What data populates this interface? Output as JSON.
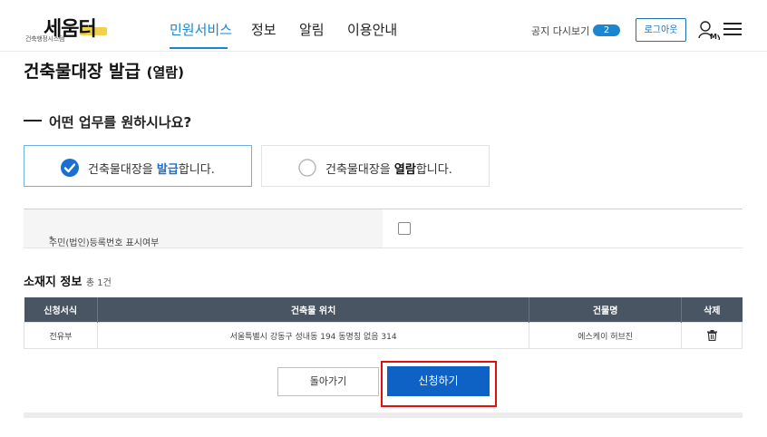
{
  "header": {
    "logo_text": "세움터",
    "logo_tagline": "건축행정시스템",
    "nav": [
      "민원서비스",
      "정보",
      "알림",
      "이용안내"
    ],
    "notice_label": "공지 다시보기",
    "notice_count": "2",
    "logout_label": "로그아웃"
  },
  "page": {
    "title": "건축물대장 발급",
    "title_sub": "(열람)"
  },
  "question": "어떤 업무를 원하시나요?",
  "options": {
    "issue": {
      "pre": "건축물대장을 ",
      "strong": "발급",
      "post": "합니다.",
      "selected": true
    },
    "view": {
      "pre": "건축물대장을 ",
      "strong": "열람",
      "post": "합니다.",
      "selected": false
    }
  },
  "resident": {
    "label": "주민(법인)등록번호 표시여부",
    "required_mark": "*",
    "checked": false
  },
  "location": {
    "title": "소재지 정보",
    "count": "총 1건",
    "columns": [
      "신청서식",
      "건축물 위치",
      "건물명",
      "삭제"
    ],
    "rows": [
      {
        "form": "전유부",
        "address": "서울특별시 강동구 성내동 194 동명칭 없음 314",
        "building": "에스케이 허브진"
      }
    ]
  },
  "buttons": {
    "back": "돌아가기",
    "apply": "신청하기"
  },
  "colors": {
    "accent": "#1a86d0",
    "apply_button": "#0e62c6",
    "table_header": "#4a5563",
    "highlight": "#e01010"
  }
}
